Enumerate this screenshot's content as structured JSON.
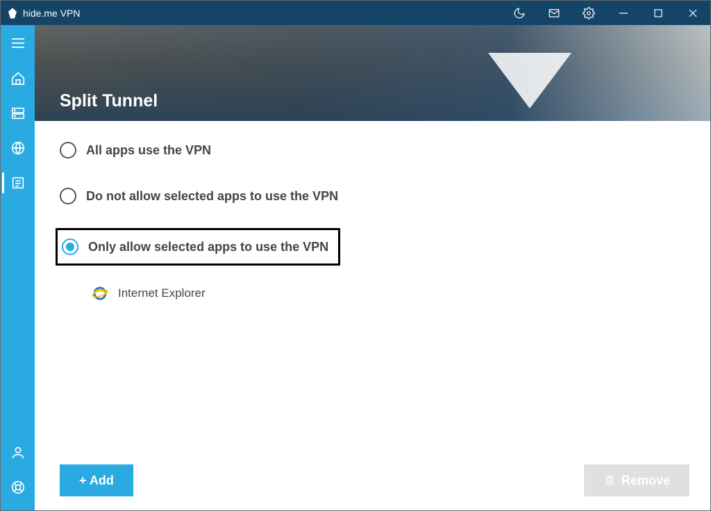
{
  "window": {
    "title": "hide.me VPN"
  },
  "page": {
    "title": "Split Tunnel"
  },
  "radios": {
    "all": {
      "label": "All apps use the VPN",
      "checked": false
    },
    "deny": {
      "label": "Do not allow selected apps to use the VPN",
      "checked": false
    },
    "allow": {
      "label": "Only allow selected apps to use the VPN",
      "checked": true
    }
  },
  "apps": {
    "items": [
      {
        "name": "Internet Explorer",
        "icon": "internet-explorer-icon"
      }
    ]
  },
  "buttons": {
    "add": "+ Add",
    "remove": "Remove"
  },
  "colors": {
    "accent": "#29abe2",
    "titlebar": "#144467",
    "highlight_border": "#000000"
  }
}
